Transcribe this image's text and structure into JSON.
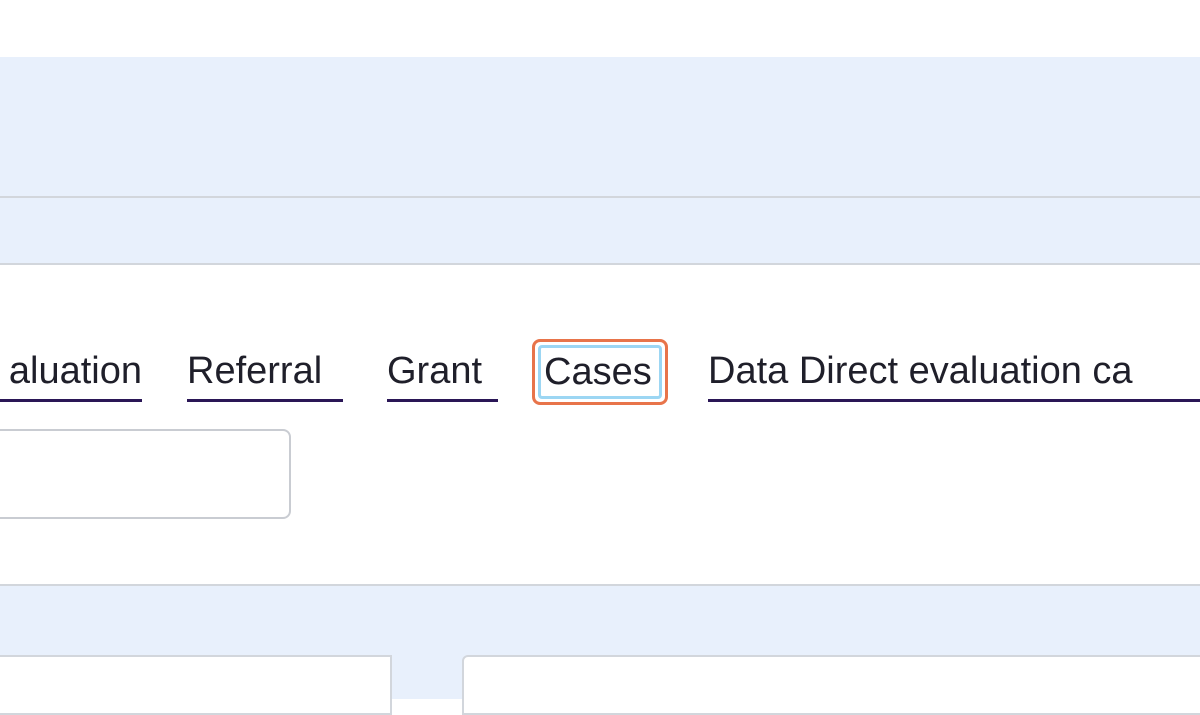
{
  "tabs": {
    "evaluation": "aluation",
    "referral": "Referral",
    "grant": "Grant",
    "cases": "Cases",
    "data_direct": "Data Direct evaluation ca"
  },
  "colors": {
    "page_background": "#e8f0fc",
    "tab_underline": "#2a1656",
    "focus_outer": "#e8744a",
    "focus_inner": "#9cd6f3"
  }
}
